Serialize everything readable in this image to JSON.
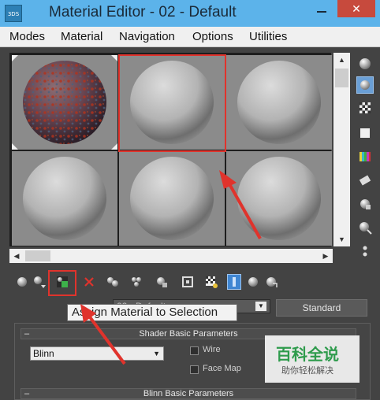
{
  "window": {
    "title": "Material Editor - 02 - Default",
    "app_icon_text": "3DS MAX",
    "close_glyph": "✕"
  },
  "menu": {
    "items": [
      "Modes",
      "Material",
      "Navigation",
      "Options",
      "Utilities"
    ]
  },
  "slots": {
    "count": 6,
    "selected_index": 1
  },
  "name_row": {
    "material_name": "02 - Default",
    "type_button": "Standard"
  },
  "tooltip": {
    "text": "Assign Material to Selection"
  },
  "shader_rollout": {
    "header": "Shader Basic Parameters",
    "shader": "Blinn",
    "wire_label": "Wire",
    "facemap_label": "Face Map",
    "collapse_glyph": "–"
  },
  "blinn_rollout": {
    "header": "Blinn Basic Parameters",
    "collapse_glyph": "–"
  },
  "watermark": {
    "title": "百科全说",
    "subtitle": "助你轻松解决"
  },
  "colors": {
    "accent_red": "#e0332c",
    "title_bar": "#5cb3ea",
    "active_blue": "#3f86d2"
  },
  "icons": [
    "sphere-icon",
    "backlight-icon",
    "checker-icon",
    "box-icon",
    "color-bars-icon",
    "options-icon",
    "video-icon",
    "select-by-material-icon",
    "material-navigator-icon"
  ]
}
